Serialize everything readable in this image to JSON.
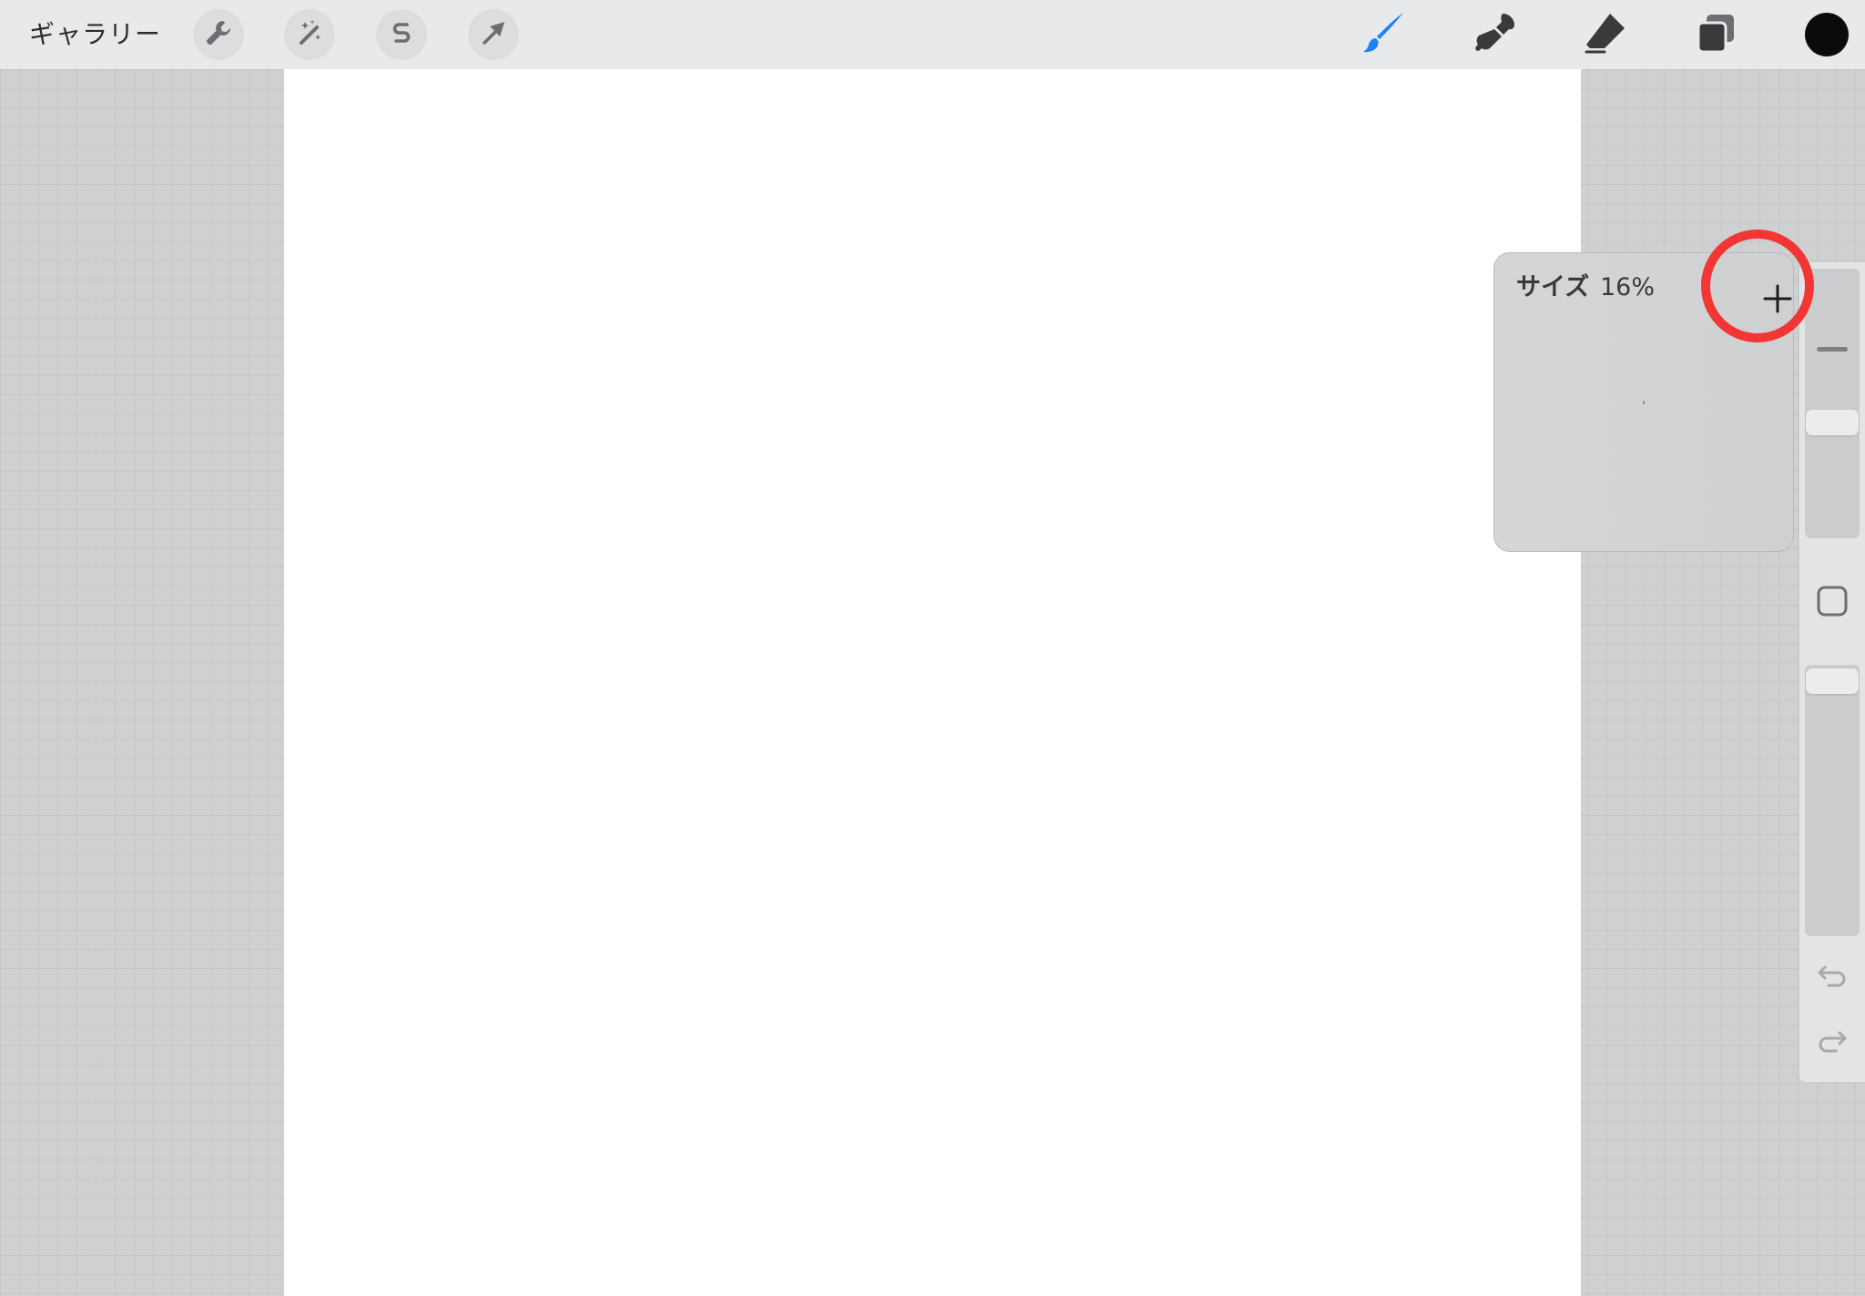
{
  "toolbar": {
    "gallery_label": "ギャラリー",
    "left_tools": [
      {
        "name": "wrench-icon",
        "label": "actions"
      },
      {
        "name": "magic-wand-icon",
        "label": "adjustments"
      },
      {
        "name": "selection-s-icon",
        "label": "selection"
      },
      {
        "name": "transform-arrow-icon",
        "label": "transform"
      }
    ],
    "right_tools": [
      {
        "name": "brush-icon",
        "active": true
      },
      {
        "name": "smudge-icon",
        "active": false
      },
      {
        "name": "eraser-icon",
        "active": false
      },
      {
        "name": "layers-icon",
        "active": false
      }
    ],
    "current_color": "#0b0b0b"
  },
  "size_popover": {
    "title": "サイズ",
    "value": "16%",
    "plus_symbol": "+"
  },
  "sidebar": {
    "brush_size_fraction": 0.16,
    "icons": [
      "minus-dash-icon",
      "modify-square-icon",
      "undo-icon",
      "redo-icon"
    ]
  },
  "colors": {
    "accent_blue": "#1b84f5",
    "highlight_red": "#f23636",
    "toolbar_bg": "#e8e9ea",
    "canvas_bg": "#ffffff"
  }
}
